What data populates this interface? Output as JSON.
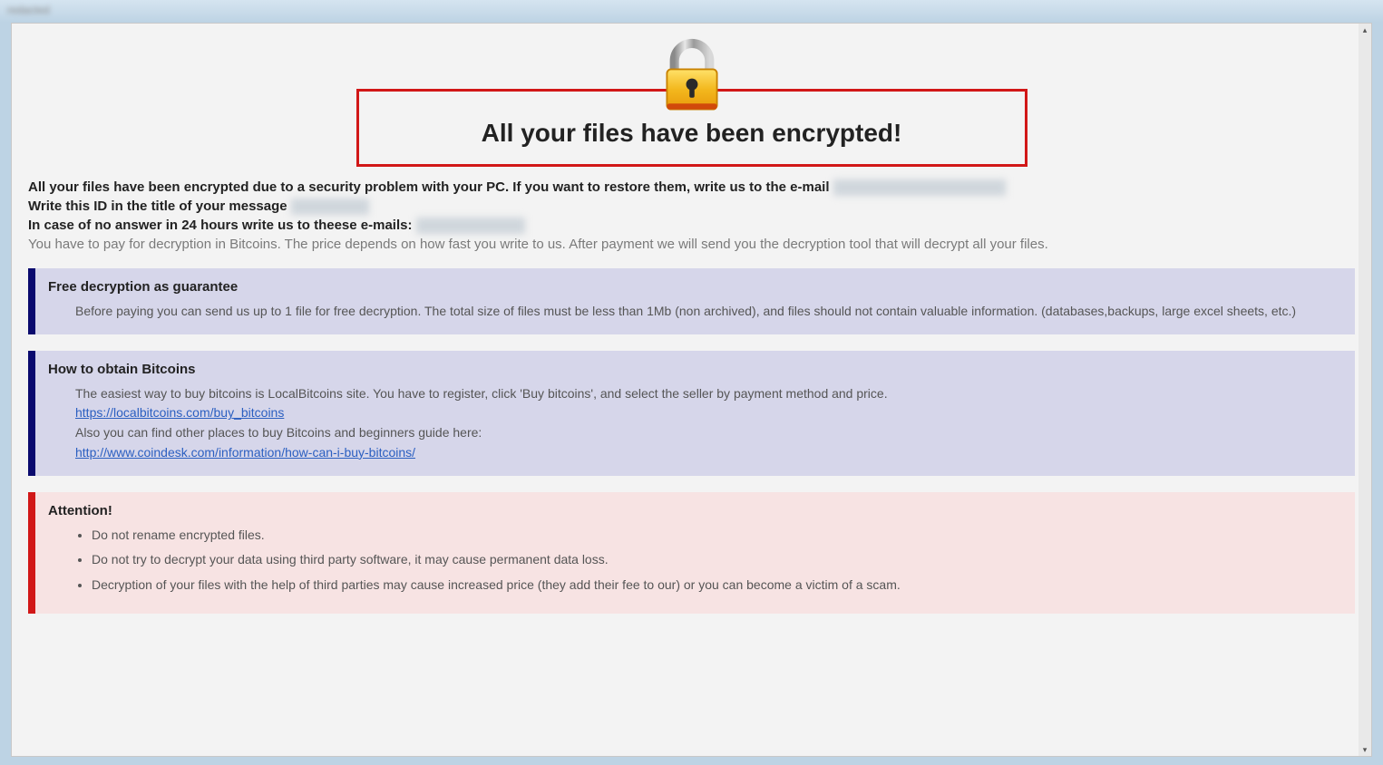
{
  "window": {
    "title": "redacted"
  },
  "header": {
    "title": "All your files have been encrypted!"
  },
  "intro": {
    "line1": "All your files have been encrypted due to a security problem with your PC. If you want to restore them, write us to the e-mail",
    "line2": "Write this ID in the title of your message",
    "line3": "In case of no answer in 24 hours write us to theese e-mails:",
    "line4": "You have to pay for decryption in Bitcoins. The price depends on how fast you write to us. After payment we will send you the decryption tool that will decrypt all your files."
  },
  "panels": {
    "guarantee": {
      "title": "Free decryption as guarantee",
      "body": "Before paying you can send us up to 1 file for free decryption. The total size of files must be less than 1Mb (non archived), and files should not contain valuable information. (databases,backups, large excel sheets, etc.)"
    },
    "bitcoin": {
      "title": "How to obtain Bitcoins",
      "line1": "The easiest way to buy bitcoins is LocalBitcoins site. You have to register, click 'Buy bitcoins', and select the seller by payment method and price.",
      "link1": "https://localbitcoins.com/buy_bitcoins",
      "line2": "Also you can find other places to buy Bitcoins and beginners guide here:",
      "link2": "http://www.coindesk.com/information/how-can-i-buy-bitcoins/"
    },
    "attention": {
      "title": "Attention!",
      "items": [
        "Do not rename encrypted files.",
        "Do not try to decrypt your data using third party software, it may cause permanent data loss.",
        "Decryption of your files with the help of third parties may cause increased price (they add their fee to our) or you can become a victim of a scam."
      ]
    }
  }
}
